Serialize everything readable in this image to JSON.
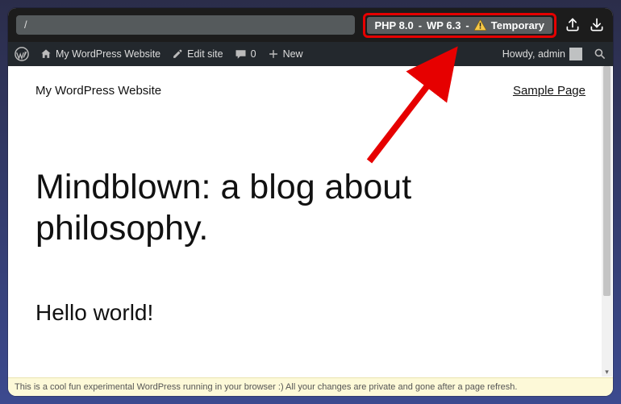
{
  "urlbar": {
    "path": "/"
  },
  "badge": {
    "php": "PHP 8.0",
    "wp": "WP 6.3",
    "status": "Temporary"
  },
  "wp_admin": {
    "site_name": "My WordPress Website",
    "edit_site": "Edit site",
    "comments_count": "0",
    "new_label": "New",
    "howdy": "Howdy, admin"
  },
  "page": {
    "site_title": "My WordPress Website",
    "sample_link": "Sample Page",
    "heading": "Mindblown: a blog about philosophy.",
    "post_title": "Hello world!"
  },
  "notice": "This is a cool fun experimental WordPress running in your browser :) All your changes are private and gone after a page refresh."
}
